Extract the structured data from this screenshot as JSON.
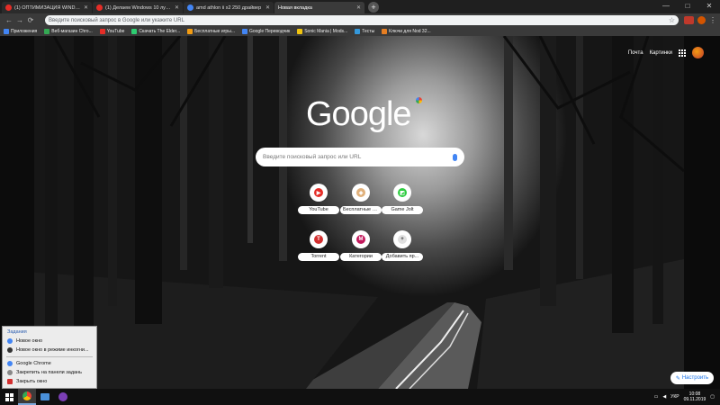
{
  "browser": {
    "tabs": [
      {
        "title": "(1) ОПТИМИЗАЦИЯ WINDOW",
        "favicon_color": "#e52d27"
      },
      {
        "title": "(1) Делаем Windows 10 лучше",
        "favicon_color": "#e52d27"
      },
      {
        "title": "amd athlon ii x2 250 драйвер",
        "favicon_color": "#4285f4"
      },
      {
        "title": "Новая вкладка",
        "favicon_color": "#5f6368",
        "active": true
      }
    ],
    "new_tab_icon": "+",
    "window_controls": [
      "—",
      "□",
      "✕"
    ],
    "nav": {
      "back": "←",
      "forward": "→",
      "reload": "⟳"
    },
    "omnibox_placeholder": "Введите поисковый запрос в Google или укажите URL",
    "star_icon": "☆",
    "menu_icon": "⋮"
  },
  "bookmarks": [
    {
      "label": "Приложения",
      "color": "#4285f4"
    },
    {
      "label": "Веб-магазин Chro...",
      "color": "#34a853"
    },
    {
      "label": "YouTube",
      "color": "#e52d27"
    },
    {
      "label": "Скачать The Elder...",
      "color": "#2ecc71"
    },
    {
      "label": "Бесплатные игры...",
      "color": "#f39c12"
    },
    {
      "label": "Google Переводчик",
      "color": "#4285f4"
    },
    {
      "label": "Sonic Mania | Mods...",
      "color": "#f1c40f"
    },
    {
      "label": "Тесты",
      "color": "#3498db"
    },
    {
      "label": "Ключи для Nod 32...",
      "color": "#e67e22"
    }
  ],
  "ntp": {
    "top_links": [
      "Почта",
      "Картинки"
    ],
    "logo": "Google",
    "search_placeholder": "Введите поисковый запрос или URL",
    "tiles": [
      {
        "label": "YouTube",
        "glyph": "▶",
        "color": "#e52d27"
      },
      {
        "label": "Бесплатные и...",
        "glyph": "◈",
        "color": "#e0b07a"
      },
      {
        "label": "Game Jolt",
        "glyph": "◩",
        "color": "#2ecc40"
      },
      {
        "label": "Torrent",
        "glyph": "T",
        "color": "#d32f2f"
      },
      {
        "label": "Категории",
        "glyph": "M",
        "color": "#c2185b"
      },
      {
        "label": "Добавить яр...",
        "glyph": "+",
        "color": "#e0e0e0"
      }
    ],
    "customize_label": "Настроить",
    "customize_icon": "✎"
  },
  "jumplist": {
    "header": "Задания",
    "items": [
      {
        "label": "Новое окно",
        "color": "#4285f4"
      },
      {
        "label": "Новое окно в режиме инкогни...",
        "color": "#333333"
      }
    ],
    "app_items": [
      {
        "label": "Google Chrome",
        "color": "#4285f4"
      },
      {
        "label": "Закрепить на панели задань",
        "color": "#888888"
      },
      {
        "label": "Закрыть окно",
        "color": "#d32f2f"
      }
    ]
  },
  "taskbar": {
    "language": "УКР",
    "time": "10:08",
    "date": "09.11.2019"
  }
}
